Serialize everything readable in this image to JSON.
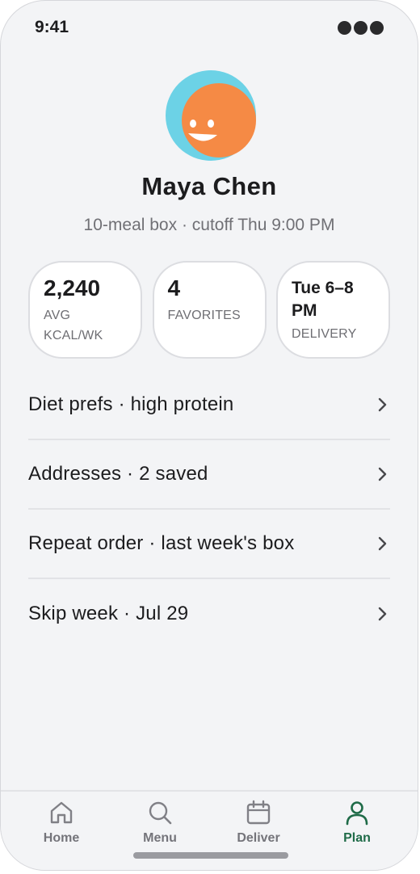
{
  "status_bar": {
    "time": "9:41"
  },
  "profile": {
    "name": "Maya Chen",
    "subtitle": "10-meal box · cutoff Thu 9:00 PM",
    "avatar_colors": {
      "back": "#6cd2e6",
      "face": "#f58a45",
      "features": "#ffffff"
    }
  },
  "stats": [
    {
      "value": "2,240",
      "label_line1": "AVG",
      "label_line2": "KCAL/WK"
    },
    {
      "value": "4",
      "label_line1": "FAVORITES"
    },
    {
      "value_line1": "Tue 6–8",
      "value_line2": "PM",
      "label_line1": "DELIVERY"
    }
  ],
  "menu": {
    "items": [
      {
        "label": "Diet prefs · high protein"
      },
      {
        "label": "Addresses · 2 saved"
      },
      {
        "label": "Repeat order · last week's box"
      },
      {
        "label": "Skip week · Jul 29"
      }
    ]
  },
  "tab_bar": {
    "tabs": [
      {
        "label": "Home",
        "icon": "home-icon"
      },
      {
        "label": "Menu",
        "icon": "search-icon"
      },
      {
        "label": "Deliver",
        "icon": "calendar-icon"
      },
      {
        "label": "Plan",
        "icon": "person-icon",
        "active": true
      }
    ],
    "active_color": "#1f6b48",
    "inactive_color": "#74747a"
  }
}
